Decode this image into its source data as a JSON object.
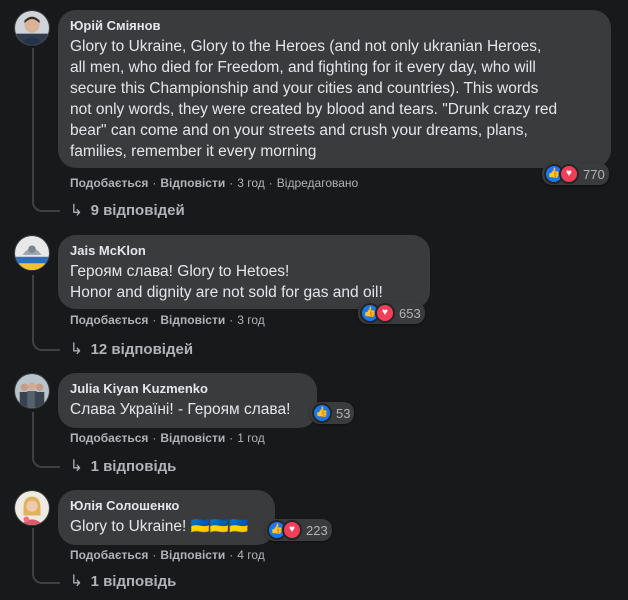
{
  "comments": [
    {
      "author": "Юрій Сміянов",
      "text_lines": [
        "Glory to Ukraine, Glory to the Heroes (and not only ukranian Heroes,",
        "all men, who died for Freedom, and fighting for it every day, who will",
        "secure this Championship and your cities and countries). This words",
        "not only words, they were created by blood and tears. \"Drunk crazy red",
        "bear\" can come and on your streets and crush your dreams, plans,",
        "families, remember it every morning"
      ],
      "reaction_count": "770",
      "like_label": "Подобається",
      "reply_label": "Відповісти",
      "time": "3 год",
      "edited": "Відредаговано",
      "replies": "9 відповідей"
    },
    {
      "author": "Jais McKlon",
      "text_lines": [
        "Героям слава! Glory to Hetoes!",
        "Honor and dignity are not sold for gas and oil!"
      ],
      "reaction_count": "653",
      "like_label": "Подобається",
      "reply_label": "Відповісти",
      "time": "3 год",
      "replies": "12 відповідей"
    },
    {
      "author": "Julia Kiyan Kuzmenko",
      "text_lines": [
        "Слава Україні! - Героям слава!"
      ],
      "reaction_count": "53",
      "like_label": "Подобається",
      "reply_label": "Відповісти",
      "time": "1 год",
      "replies": "1 відповідь"
    },
    {
      "author": "Юлія Солошенко",
      "text_lines": [
        "Glory to Ukraine! 🇺🇦🇺🇦🇺🇦"
      ],
      "reaction_count": "223",
      "like_label": "Подобається",
      "reply_label": "Відповісти",
      "time": "4 год",
      "replies": "1 відповідь"
    }
  ],
  "colors": {
    "background": "#18191a",
    "bubble": "#3a3b3c",
    "text": "#e4e6eb",
    "secondary_text": "#b0b3b8",
    "like": "#1877f2",
    "love": "#f33e58"
  }
}
